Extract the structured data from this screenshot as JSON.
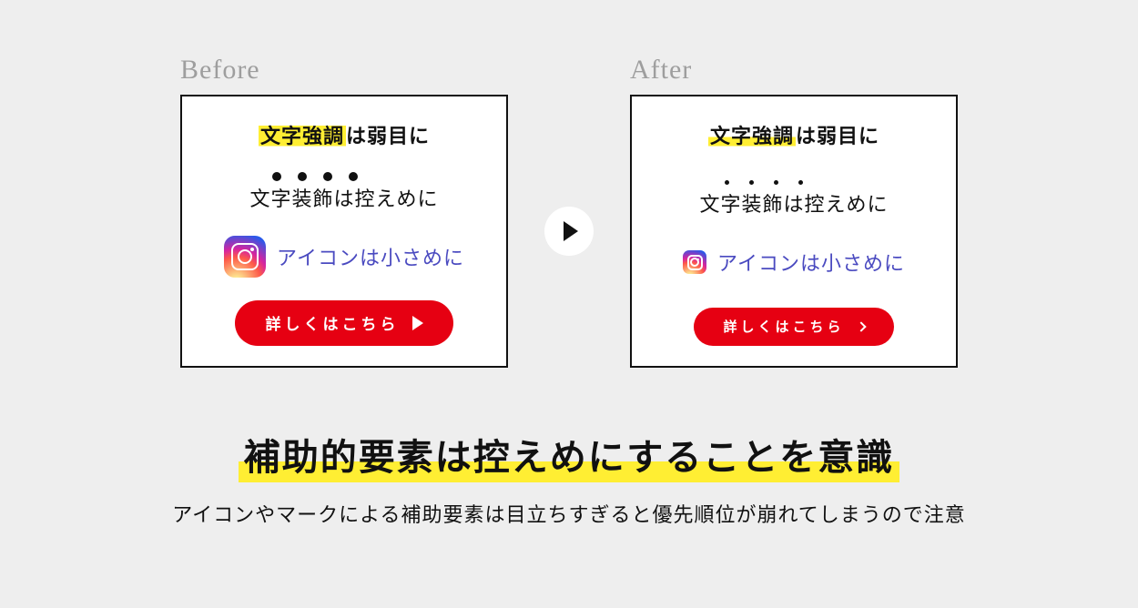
{
  "labels": {
    "before": "Before",
    "after": "After"
  },
  "panel": {
    "line1_emph": "文字強調",
    "line1_rest": "は弱目に",
    "line2": "文字装飾は控えめに",
    "line3": "アイコンは小さめに",
    "cta": "詳しくはこちら"
  },
  "caption": {
    "headline": "補助的要素は控えめにすることを意識",
    "subline": "アイコンやマークによる補助要素は目立ちすぎると優先順位が崩れてしまうので注意"
  },
  "icons": {
    "instagram": "instagram-icon",
    "play": "play-icon",
    "chevron": "chevron-right-icon"
  }
}
